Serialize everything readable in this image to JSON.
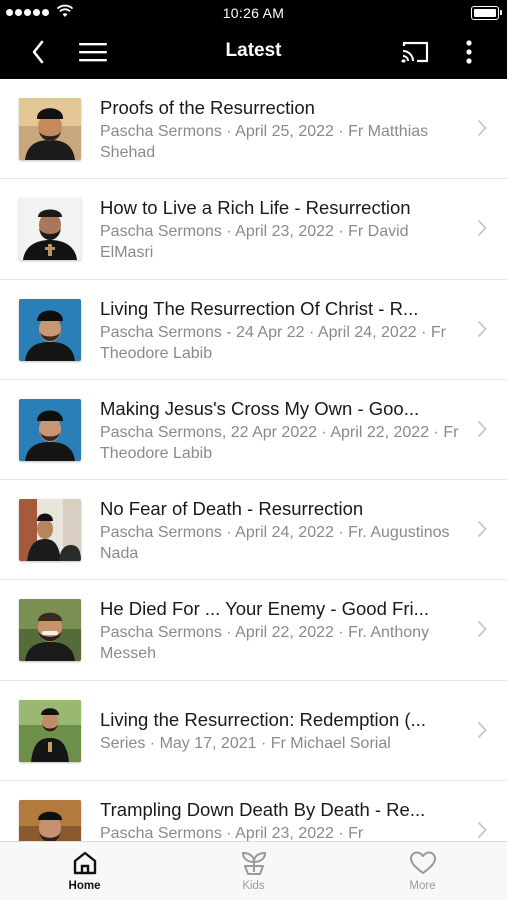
{
  "status_bar": {
    "time": "10:26 AM"
  },
  "nav": {
    "title": "Latest"
  },
  "items": [
    {
      "title": "Proofs of the Resurrection",
      "subtitle": "Pascha Sermons · April 25, 2022 · Fr Matthias Shehad",
      "icon": "speaker-photo"
    },
    {
      "title": "How to Live a Rich Life - Resurrection",
      "subtitle": "Pascha Sermons · April 23, 2022 · Fr David ElMasri",
      "icon": "speaker-photo"
    },
    {
      "title": "Living The Resurrection Of Christ - R...",
      "subtitle": "Pascha Sermons - 24 Apr 22 · April 24, 2022 · Fr Theodore Labib",
      "icon": "speaker-photo"
    },
    {
      "title": "Making Jesus's Cross My Own - Goo...",
      "subtitle": "Pascha Sermons, 22 Apr 2022 · April 22, 2022 · Fr Theodore Labib",
      "icon": "speaker-photo"
    },
    {
      "title": "No Fear of Death - Resurrection",
      "subtitle": "Pascha Sermons · April 24, 2022 · Fr. Augustinos Nada",
      "icon": "speaker-photo"
    },
    {
      "title": "He Died For ... Your Enemy - Good Fri...",
      "subtitle": "Pascha Sermons · April 22, 2022 · Fr. Anthony Messeh",
      "icon": "speaker-photo"
    },
    {
      "title": "Living the Resurrection: Redemption (...",
      "subtitle": "Series · May 17, 2021 · Fr Michael Sorial",
      "icon": "speaker-photo"
    },
    {
      "title": "Trampling Down Death By Death - Re...",
      "subtitle": "Pascha Sermons · April 23, 2022 · Fr",
      "icon": "speaker-photo"
    }
  ],
  "tabs": [
    {
      "label": "Home",
      "icon": "home-icon",
      "active": true
    },
    {
      "label": "Kids",
      "icon": "sprout-icon",
      "active": false
    },
    {
      "label": "More",
      "icon": "heart-icon",
      "active": false
    }
  ],
  "colors": {
    "bar": "#000000",
    "title_text": "#1a1a1a",
    "subtitle_text": "#8a8a8a",
    "divider": "#e3e3e3"
  }
}
